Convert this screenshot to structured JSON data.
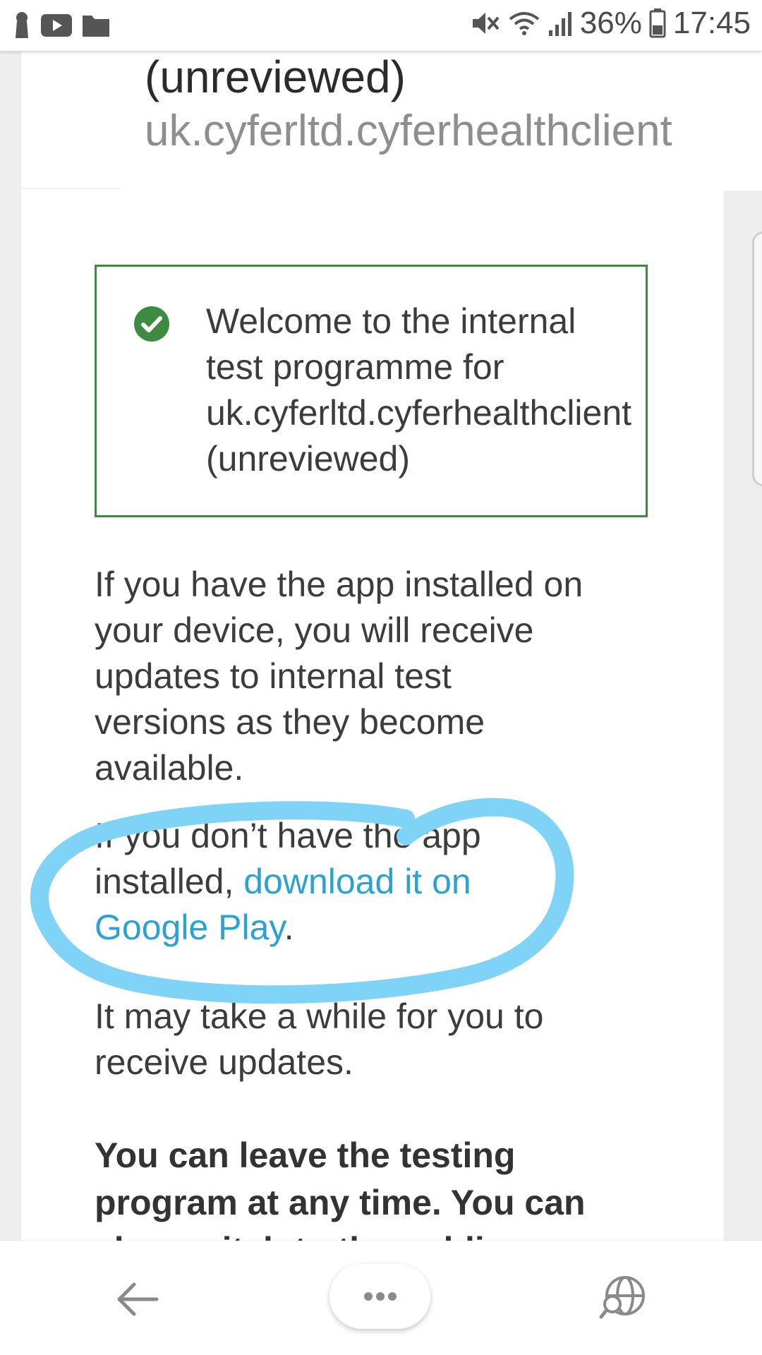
{
  "status_bar": {
    "battery": "36%",
    "time": "17:45",
    "left_icons": [
      "keyhole-icon",
      "youtube-icon",
      "folder-icon"
    ],
    "right_icons": [
      "mute-icon",
      "wifi-icon",
      "signal-icon",
      "battery-icon"
    ]
  },
  "header": {
    "app_title": "(unreviewed)",
    "app_package": "uk.cyferltd.cyferhealthclient"
  },
  "welcome_box": {
    "lines": [
      "Welcome to the internal",
      "test programme for",
      "uk.cyferltd.cyferhealthclient",
      "(unreviewed)"
    ],
    "border_color": "#3d8b40",
    "icon": "check-circle-icon"
  },
  "paragraph1": {
    "lines": [
      "If you have the app installed on",
      "your device, you will receive",
      "updates to internal test",
      "versions as they become",
      "available."
    ]
  },
  "paragraph2": {
    "line1": "If you don’t have the app",
    "line2_prefix": "installed, ",
    "link_part1": "download it on",
    "link_part2": "Google Play",
    "suffix": "."
  },
  "paragraph3": {
    "lines": [
      "It may take a while for you to",
      "receive updates."
    ]
  },
  "bold_paragraph": {
    "lines": [
      "You can leave the testing",
      "program at any time. You can",
      "also switch to the public"
    ]
  },
  "annotation": {
    "color": "#7fd3f7"
  },
  "link_color": "#2aa3d3",
  "bottom_nav": {
    "back_icon": "back-arrow-icon",
    "menu_icon": "more-dots-icon",
    "web_icon": "globe-search-icon"
  }
}
